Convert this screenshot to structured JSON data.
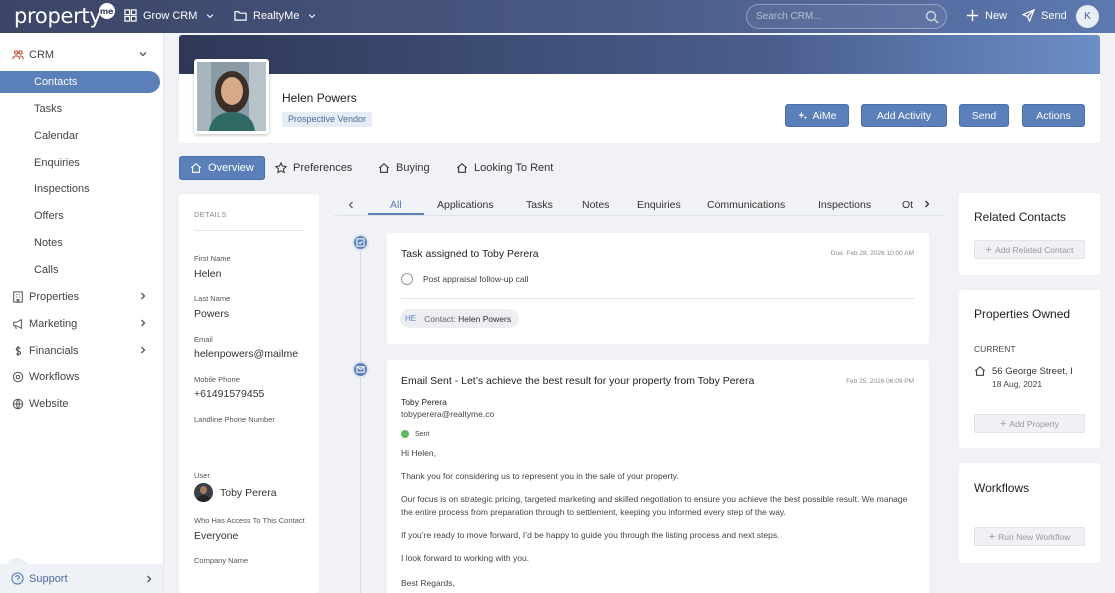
{
  "topbar": {
    "logo": "property",
    "logo_badge": "me",
    "workspace": "Grow CRM",
    "folder": "RealtyMe",
    "search_placeholder": "Search CRM...",
    "new_label": "New",
    "send_label": "Send",
    "user_initial": "K"
  },
  "sidebar": {
    "crm": "CRM",
    "items": [
      {
        "label": "Contacts"
      },
      {
        "label": "Tasks"
      },
      {
        "label": "Calendar"
      },
      {
        "label": "Enquiries"
      },
      {
        "label": "Inspections"
      },
      {
        "label": "Offers"
      },
      {
        "label": "Notes"
      },
      {
        "label": "Calls"
      }
    ],
    "properties": "Properties",
    "marketing": "Marketing",
    "financials": "Financials",
    "workflows": "Workflows",
    "website": "Website",
    "support": "Support"
  },
  "contact": {
    "name": "Helen Powers",
    "tag": "Prospective Vendor",
    "actions": {
      "aime": "AiMe",
      "add_activity": "Add Activity",
      "send": "Send",
      "actions": "Actions"
    }
  },
  "profile_tabs": [
    "Overview",
    "Preferences",
    "Buying",
    "Looking To Rent"
  ],
  "details": {
    "heading": "DETAILS",
    "first_name_label": "First Name",
    "first_name": "Helen",
    "last_name_label": "Last Name",
    "last_name": "Powers",
    "email_label": "Email",
    "email": "helenpowers@mailme",
    "mobile_label": "Mobile Phone",
    "mobile": "+61491579455",
    "landline_label": "Landline Phone Number",
    "user_label": "User",
    "user": "Toby Perera",
    "access_label": "Who Has Access To This Contact",
    "access": "Everyone",
    "company_label": "Company Name"
  },
  "activity_tabs": [
    "All",
    "Applications",
    "Tasks",
    "Notes",
    "Enquiries",
    "Communications",
    "Inspections",
    "Ot"
  ],
  "task_card": {
    "title": "Task assigned to Toby Perera",
    "due": "Due: Feb 28, 2026 10:00 AM",
    "item": "Post appraisal follow-up call",
    "chip_initials": "HE",
    "chip_prefix": "Contact:",
    "chip_name": "Helen Powers"
  },
  "email_card": {
    "title": "Email Sent - Let’s achieve the best result for your property from Toby Perera",
    "date": "Feb 25, 2026 06:09 PM",
    "from_name": "Toby Perera",
    "from_email": "tobyperera@realtyme.co",
    "status": "Sent",
    "status_color": "#5cb85c",
    "body": [
      "Hi Helen,",
      "Thank you for considering us to represent you in the sale of your property.",
      "Our focus is on strategic pricing, targeted marketing and skilled negotiation to ensure you achieve the best possible result. We manage the entire process from preparation through to settlement, keeping you informed every step of the way.",
      "If you’re ready to move forward, I’d be happy to guide you through the listing process and next steps.",
      "I look forward to working with you.",
      "Best Regards,"
    ]
  },
  "right": {
    "related_title": "Related Contacts",
    "add_related": "Add Related Contact",
    "owned_title": "Properties Owned",
    "current_label": "CURRENT",
    "property_address": "56 George Street, I",
    "property_date": "18 Aug, 2021",
    "add_property": "Add Property",
    "workflows_title": "Workflows",
    "run_workflow": "Run New Workflow"
  },
  "colors": {
    "accent": "#5a7fb9",
    "topbar": "#3b4566"
  }
}
